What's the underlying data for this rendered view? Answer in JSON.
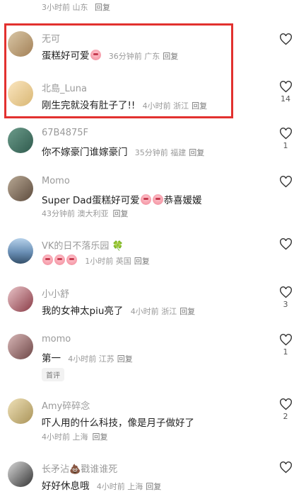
{
  "top_meta": {
    "time": "3小时前",
    "location": "山东",
    "reply": "回复"
  },
  "comments": [
    {
      "username": "无可",
      "text": "蛋糕好可爱",
      "emoji_count": 1,
      "time": "36分钟前",
      "location": "广东",
      "reply": "回复",
      "likes": "",
      "avatar_color": "#c8b08a"
    },
    {
      "username": "北島_Luna",
      "text": "刚生完就没有肚子了!!",
      "time": "4小时前",
      "location": "浙江",
      "reply": "回复",
      "likes": "14",
      "avatar_color": "#f0d7a2"
    },
    {
      "username": "67B4875F",
      "text": "你不嫁豪门谁嫁豪门",
      "time": "35分钟前",
      "location": "福建",
      "reply": "回复",
      "likes": "1",
      "avatar_color": "#4a7d6f"
    },
    {
      "username": "Momo",
      "text_a": "Super Dad蛋糕好可爱",
      "text_b": "恭喜媛媛",
      "time": "43分钟前",
      "location": "澳大利亚",
      "reply": "回复",
      "likes": "",
      "avatar_color": "#8d7a6a"
    },
    {
      "username": "VK的日不落乐园",
      "suffix_emoji": "🍀",
      "time": "1小时前",
      "location": "英国",
      "reply": "回复",
      "likes": "",
      "avatar_color": "#6a8fb5"
    },
    {
      "username": "小小舒",
      "text": "我的女神太piu亮了",
      "time": "4小时前",
      "location": "浙江",
      "reply": "回复",
      "likes": "3",
      "avatar_color": "#b55a66"
    },
    {
      "username": "momo",
      "text": "第一",
      "time": "4小时前",
      "location": "江苏",
      "reply": "回复",
      "badge": "首评",
      "likes": "1",
      "avatar_color": "#9c6e6e"
    },
    {
      "username": "Amy碎碎念",
      "text": "吓人用的什么科技，像是月子做好了",
      "time": "4小时前",
      "location": "上海",
      "reply": "回复",
      "likes": "2",
      "avatar_color": "#d8c79b"
    },
    {
      "username": "长矛沾",
      "suffix_emoji": "💩",
      "username_b": "戳谁谁死",
      "text": "好好休息哦",
      "time": "4小时前",
      "location": "上海",
      "reply": "回复",
      "likes": "",
      "avatar_color": "#444444"
    }
  ]
}
